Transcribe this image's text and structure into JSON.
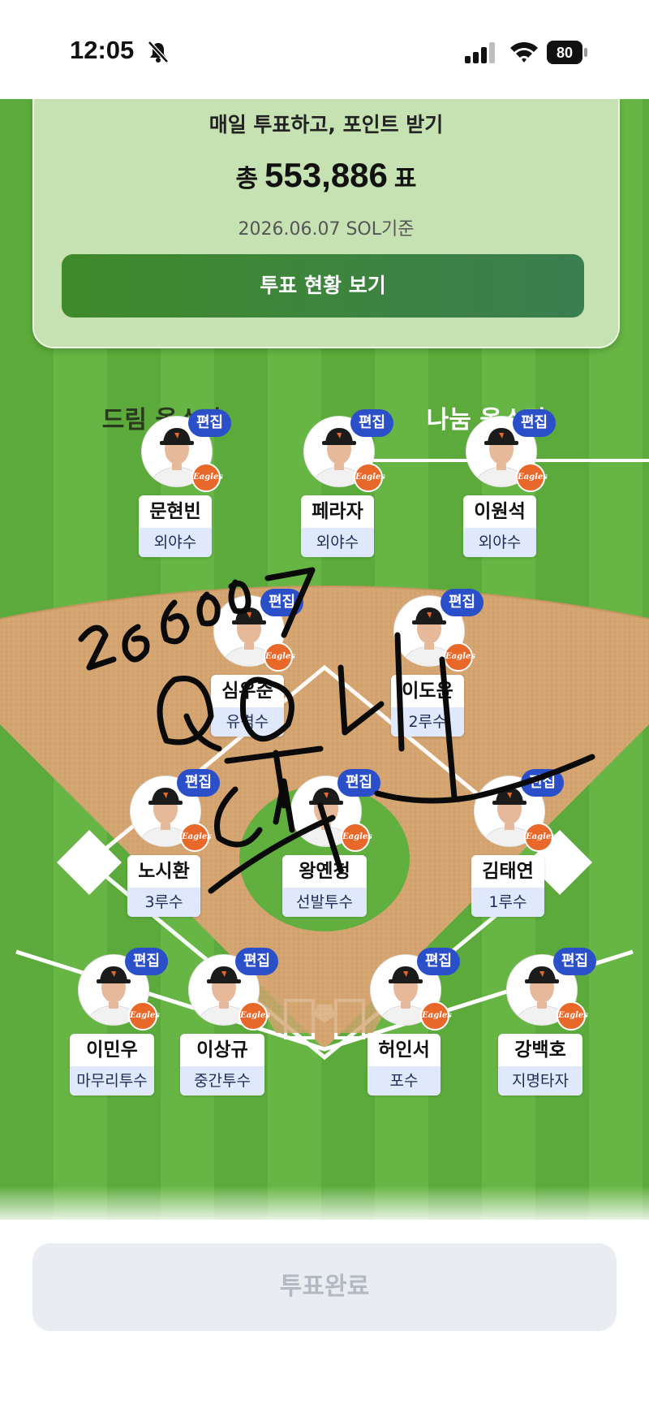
{
  "status_bar": {
    "time": "12:05",
    "battery": "80"
  },
  "vote_card": {
    "subtitle": "매일 투표하고, 포인트 받기",
    "total_prefix": "총",
    "total_votes": "553,886",
    "total_suffix": "표",
    "date": "2026.06.07 SOL기준",
    "status_button": "투표 현황 보기"
  },
  "tabs": [
    {
      "label": "드림 올스타",
      "selected": false
    },
    {
      "label": "나눔 올스타",
      "selected": true
    }
  ],
  "edit_label": "편집",
  "team_logo_text": "Eagles",
  "players": [
    {
      "name": "문현빈",
      "position": "외야수"
    },
    {
      "name": "페라자",
      "position": "외야수"
    },
    {
      "name": "이원석",
      "position": "외야수"
    },
    {
      "name": "심우준",
      "position": "유격수"
    },
    {
      "name": "이도윤",
      "position": "2루수"
    },
    {
      "name": "노시환",
      "position": "3루수"
    },
    {
      "name": "왕옌청",
      "position": "선발투수"
    },
    {
      "name": "김태연",
      "position": "1루수"
    },
    {
      "name": "이민우",
      "position": "마무리투수"
    },
    {
      "name": "이상규",
      "position": "중간투수"
    },
    {
      "name": "허인서",
      "position": "포수"
    },
    {
      "name": "강백호",
      "position": "지명타자"
    }
  ],
  "handwriting": {
    "date_scrawl": "260607"
  },
  "done_button": "투표완료",
  "colors": {
    "edit_badge": "#2a4fc9",
    "position_bg": "#dfe9fb",
    "card_button": "#3f8a2a",
    "field_green": "#5caa3b",
    "infield_dirt": "#d4a471"
  }
}
